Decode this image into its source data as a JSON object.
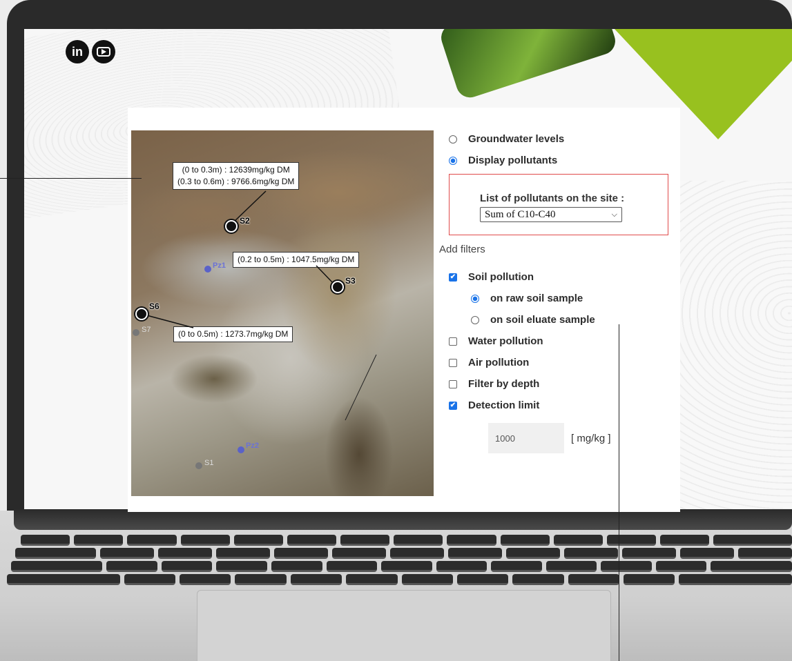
{
  "social": {
    "linkedin_label": "in"
  },
  "map": {
    "labels": [
      {
        "lines": [
          "(0 to 0.3m) : 12639mg/kg DM",
          "(0.3 to 0.6m) : 9766.6mg/kg DM"
        ]
      },
      {
        "lines": [
          "(0.2 to 0.5m) : 1047.5mg/kg DM"
        ]
      },
      {
        "lines": [
          "(0 to 0.5m) : 1273.7mg/kg DM"
        ]
      }
    ],
    "points": {
      "s2": "S2",
      "s3": "S3",
      "s6": "S6",
      "s7": "S7",
      "s1": "S1"
    },
    "blue_points": {
      "pz1": "Pz1",
      "pz2": "Pz2"
    }
  },
  "options": {
    "groundwater": "Groundwater levels",
    "display_pollutants": "Display pollutants",
    "pollutant_list_title": "List of pollutants on the site :",
    "pollutant_selected": "Sum of C10-C40",
    "add_filters": "Add filters",
    "soil_pollution": "Soil pollution",
    "raw_soil": "on raw soil sample",
    "eluate_soil": "on soil eluate sample",
    "water_pollution": "Water pollution",
    "air_pollution": "Air pollution",
    "filter_depth": "Filter by depth",
    "detection_limit": "Detection limit",
    "detection_value": "1000",
    "unit": "[ mg/kg ]"
  },
  "state": {
    "groundwater": false,
    "display_pollutants": true,
    "soil_pollution": true,
    "raw_soil": true,
    "eluate_soil": false,
    "water_pollution": false,
    "air_pollution": false,
    "filter_depth": false,
    "detection_limit": true
  },
  "colors": {
    "accent_green": "#98c11f",
    "selected_blue": "#1a73e8",
    "box_red": "#e04a4a"
  }
}
